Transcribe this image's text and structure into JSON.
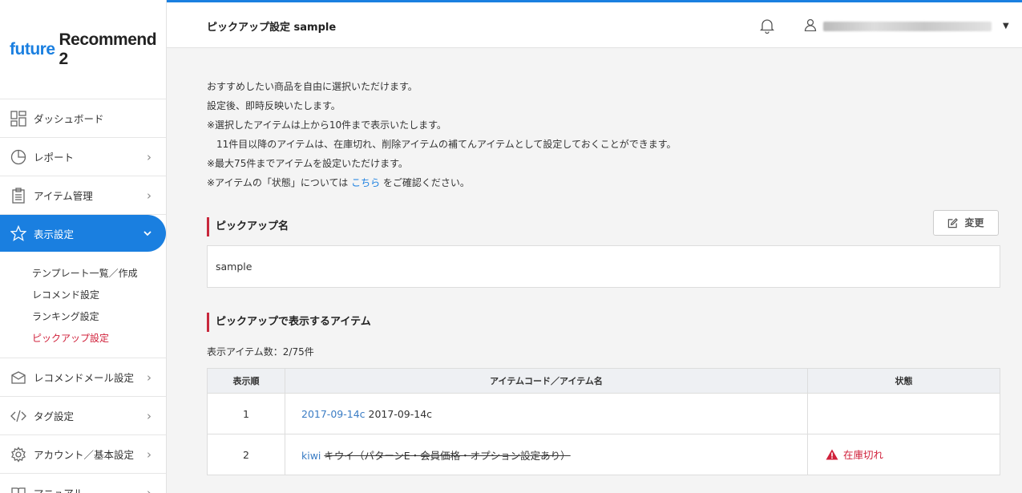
{
  "brand": {
    "part1": "future",
    "part2": "Recommend 2"
  },
  "sidebar": {
    "items": [
      {
        "label": "ダッシュボード",
        "icon": "dashboard-icon"
      },
      {
        "label": "レポート",
        "icon": "pie-chart-icon"
      },
      {
        "label": "アイテム管理",
        "icon": "clipboard-icon"
      },
      {
        "label": "表示設定",
        "icon": "star-icon"
      },
      {
        "label": "レコメンドメール設定",
        "icon": "mail-icon"
      },
      {
        "label": "タグ設定",
        "icon": "code-icon"
      },
      {
        "label": "アカウント／基本設定",
        "icon": "gear-icon"
      },
      {
        "label": "マニュアル",
        "icon": "book-icon"
      }
    ],
    "subitems": [
      "テンプレート一覧／作成",
      "レコメンド設定",
      "ランキング設定",
      "ピックアップ設定"
    ]
  },
  "header": {
    "title": "ピックアップ設定 sample"
  },
  "intro": {
    "line1": "おすすめしたい商品を自由に選択いただけます。",
    "line2": "設定後、即時反映いたします。",
    "line3": "※選択したアイテムは上から10件まで表示いたします。",
    "line4": "　11件目以降のアイテムは、在庫切れ、削除アイテムの補てんアイテムとして設定しておくことができます。",
    "line5": "※最大75件までアイテムを設定いただけます。",
    "line6_pre": "※アイテムの「状態」については ",
    "line6_link": "こちら",
    "line6_post": " をご確認ください。"
  },
  "pickup_name": {
    "heading": "ピックアップ名",
    "edit_label": "変更",
    "value": "sample"
  },
  "items_section": {
    "heading": "ピックアップで表示するアイテム",
    "count_label": "表示アイテム数：2/75件",
    "columns": [
      "表示順",
      "アイテムコード／アイテム名",
      "状態"
    ],
    "rows": [
      {
        "order": "1",
        "code": "2017-09-14c",
        "name": "2017-09-14c",
        "status": ""
      },
      {
        "order": "2",
        "code": "kiwi",
        "name": "キウイ（パターンE・会員価格・オプション設定あり）",
        "status": "在庫切れ"
      }
    ]
  }
}
